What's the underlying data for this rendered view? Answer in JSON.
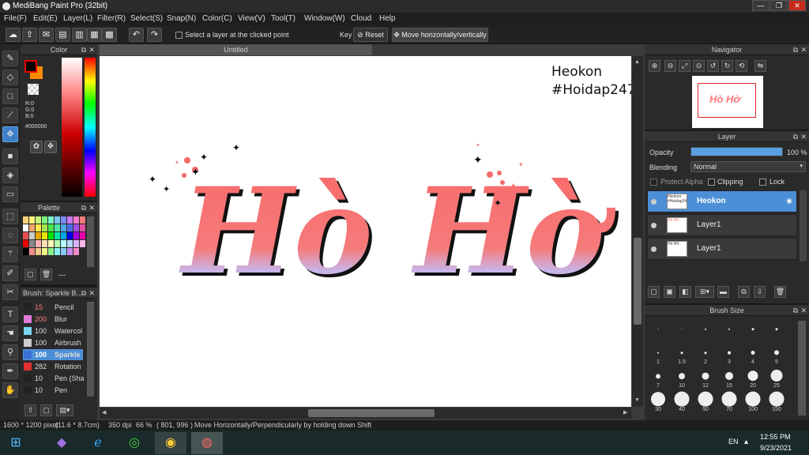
{
  "app": {
    "title": "MediBang Paint Pro (32bit)",
    "win_min": "—",
    "win_max": "❐",
    "win_close": "✕"
  },
  "menu": [
    "File(F)",
    "Edit(E)",
    "Layer(L)",
    "Filter(R)",
    "Select(S)",
    "Snap(N)",
    "Color(C)",
    "View(V)",
    "Tool(T)",
    "Window(W)",
    "Cloud",
    "Help"
  ],
  "toolbar": {
    "select_layer_label": "Select a layer at the clicked point",
    "key_label": "Key",
    "reset_label": "Reset",
    "move_hv_label": "Move horizontally/vertically"
  },
  "color_panel": {
    "title": "Color",
    "r": "R:0",
    "g": "G:0",
    "b": "B:0",
    "hex": "#000000",
    "fg_color": "#000000",
    "bg_color": "#ff8a00"
  },
  "palette_panel": {
    "title": "Palette",
    "swatches": [
      "#ffd27a",
      "#fff27a",
      "#c8f27a",
      "#7af27a",
      "#7af2c8",
      "#7ac8f2",
      "#7a8af2",
      "#c87af2",
      "#f27ac8",
      "#f27a7a",
      "#ffffff",
      "#f2a66e",
      "#ffe64d",
      "#a6e64d",
      "#4de64d",
      "#4de6a6",
      "#4da6e6",
      "#4d6ee6",
      "#a64de6",
      "#e64da6",
      "#e64d4d",
      "#cccccc",
      "#e6a600",
      "#e6e600",
      "#00e600",
      "#00e6a6",
      "#00a6e6",
      "#0000e6",
      "#a600e6",
      "#e600a6",
      "#e60000",
      "#888888",
      "#ffb3b3",
      "#ffe0b3",
      "#ffffb3",
      "#b3ffb3",
      "#b3ffff",
      "#b3d9ff",
      "#d9b3ff",
      "#ffb3e6",
      "#000000",
      "#f28a8a",
      "#f2c88a",
      "#f2f28a",
      "#8af28a",
      "#8af2f2",
      "#8ac8f2",
      "#c88af2",
      "#f28ac8"
    ],
    "footer": "---"
  },
  "brush_panel": {
    "title": "Brush: Sparkle B...",
    "items": [
      {
        "size": "15",
        "name": "Pencil",
        "color": "#222222",
        "size_color": "#ff8080"
      },
      {
        "size": "200",
        "name": "Blur",
        "color": "#e07ad6",
        "size_color": "#ff8080"
      },
      {
        "size": "100",
        "name": "Watercol",
        "color": "#7ad6f0",
        "size_color": "#dddddd"
      },
      {
        "size": "100",
        "name": "Airbrush",
        "color": "#cccccc",
        "size_color": "#dddddd"
      },
      {
        "size": "100",
        "name": "Sparkle",
        "color": "#3a6fd6",
        "size_color": "#ffffff"
      },
      {
        "size": "282",
        "name": "Rotation",
        "color": "#e03030",
        "size_color": "#dddddd"
      },
      {
        "size": "10",
        "name": "Pen (Sha",
        "color": "#222222",
        "size_color": "#dddddd"
      },
      {
        "size": "10",
        "name": "Pen",
        "color": "#222222",
        "size_color": "#dddddd"
      }
    ]
  },
  "canvas": {
    "tab": "Untitled",
    "watermark_1": "Heokon",
    "watermark_2": "#Hoidap247",
    "art_text": "Hò Hờ"
  },
  "navigator": {
    "title": "Navigator"
  },
  "layer_panel": {
    "title": "Layer",
    "opacity_label": "Opacity",
    "opacity_value": "100 %",
    "opacity_fraction": 1.0,
    "blending_label": "Blending",
    "blending_value": "Normal",
    "protect_alpha": "Protect Alpha",
    "clipping": "Clipping",
    "lock": "Lock",
    "layers": [
      {
        "name": "Heokon",
        "thumb": "Heokon #Hoidap247",
        "selected": true
      },
      {
        "name": "Layer1",
        "thumb": "Hò Hờ",
        "selected": false
      },
      {
        "name": "Layer1",
        "thumb": "Hò Hờ",
        "selected": false
      }
    ]
  },
  "brush_size_panel": {
    "title": "Brush Size",
    "sizes": [
      "",
      "",
      "",
      "",
      "",
      "",
      "1",
      "1.5",
      "2",
      "3",
      "4",
      "5",
      "7",
      "10",
      "12",
      "15",
      "20",
      "25",
      "30",
      "40",
      "50",
      "70",
      "100",
      "150"
    ]
  },
  "status": {
    "size": "1600 * 1200 pixel",
    "cm": "(11.6 * 8.7cm)",
    "dpi": "350 dpi",
    "zoom": "66 %",
    "coords": "( 801, 996 )",
    "message": "Move Horizontally/Perpendicularly by holding down Shift"
  },
  "taskbar": {
    "lang": "EN",
    "time": "12:55 PM",
    "date": "9/23/2021"
  }
}
